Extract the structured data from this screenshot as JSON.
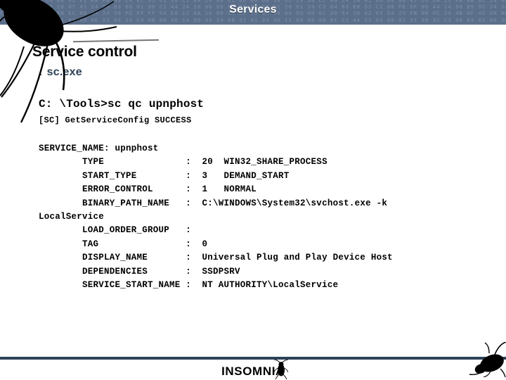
{
  "header": {
    "title": "Services",
    "band_color": "#5c6f8a",
    "title_color": "#ffffff",
    "hex_texture": "B2 3A 8D E1 53 E8 42 F1 EB FB 83 C4 EC 85 01 24 C1 44 24 04 01 00 00 00 39 5C 24 38 C7 44 24 10 01 00 00 00 01 D3 54 25 FB 0B 0C 24 4B 0F 45 00 BD EC 51 EC 53 E8 41 21 0C 54 42 25 00 00\n74 0A 11 30 0D 10 07 41 24 06 03 80 01 00 C2 44 24 10 00 00 00 00 01 89 5C 20 01 23 C3 04 03 E8 52 C2 88 FE 8F 00 44 24 06 09 5C 24 38 27 71 5A F2 F9 8D A1 21 06 01 90 00 8D 44 24 08\nC0 22 C3 9D 55 8B EC 8D A4 24 30 FD FF FF 54 E8 11 0A 10 00 54 24 10 00 00 00 09 00 01 89 54 20 02 D3 54 25 FB 0B 0C 24 4B 0F 45 00 BD 11 01 00 09 91 C3 43 04 01 51 EE 75 0B E8\nFF F5 54 EE 11 01 01 00 0E 03 04 24 C4 0B 00 30 14 9D 44 24 08 31 41 24 30 11 00 09 00 81 23 44 21 01 00 01 31 99 32 C3 49 04 01 00 30 14 9D 20 FF 24 24 20 EF 74 24 20 EB 0E 00 00\n7D FF FF 50 E8 8F FF EB EF CC 91 BA 4D 11 1C 77 EB 08 90 BA 74 10 1C 77 8D 09 53 56 57 33 C0 33 DE 33 F1 33 FE FF 74 24 20 FF 74 24 20 FF 74 24 20 EF 74 24 20 EB 0E 00 00 00 00"
  },
  "slide": {
    "title": "Service control",
    "subtitle_prefix": ":",
    "subtitle": "sc.exe",
    "subtitle_color": "#2d4257"
  },
  "console": {
    "command_line": "C: \\Tools>sc qc upnphost",
    "status_line": "[SC] GetServiceConfig SUCCESS",
    "output": "SERVICE_NAME: upnphost\n        TYPE               :  20  WIN32_SHARE_PROCESS\n        START_TYPE         :  3   DEMAND_START\n        ERROR_CONTROL      :  1   NORMAL\n        BINARY_PATH_NAME   :  C:\\WINDOWS\\System32\\svchost.exe -k\nLocalService\n        LOAD_ORDER_GROUP   :\n        TAG                :  0\n        DISPLAY_NAME       :  Universal Plug and Play Device Host\n        DEPENDENCIES       :  SSDPSRV\n        SERVICE_START_NAME :  NT AUTHORITY\\LocalService",
    "fields": [
      {
        "name": "SERVICE_NAME",
        "value": "upnphost"
      },
      {
        "name": "TYPE",
        "code": "20",
        "value": "WIN32_SHARE_PROCESS"
      },
      {
        "name": "START_TYPE",
        "code": "3",
        "value": "DEMAND_START"
      },
      {
        "name": "ERROR_CONTROL",
        "code": "1",
        "value": "NORMAL"
      },
      {
        "name": "BINARY_PATH_NAME",
        "value": "C:\\WINDOWS\\System32\\svchost.exe -k LocalService"
      },
      {
        "name": "LOAD_ORDER_GROUP",
        "value": ""
      },
      {
        "name": "TAG",
        "value": "0"
      },
      {
        "name": "DISPLAY_NAME",
        "value": "Universal Plug and Play Device Host"
      },
      {
        "name": "DEPENDENCIES",
        "value": "SSDPSRV"
      },
      {
        "name": "SERVICE_START_NAME",
        "value": "NT AUTHORITY\\LocalService"
      }
    ]
  },
  "footer": {
    "brand": "INSOMNIA",
    "rule_color": "#2d4257"
  },
  "decorations": {
    "bug_top_left": "cockroach-icon",
    "bug_bottom_right": "cockroach-icon",
    "bug_footer": "cockroach-icon"
  }
}
